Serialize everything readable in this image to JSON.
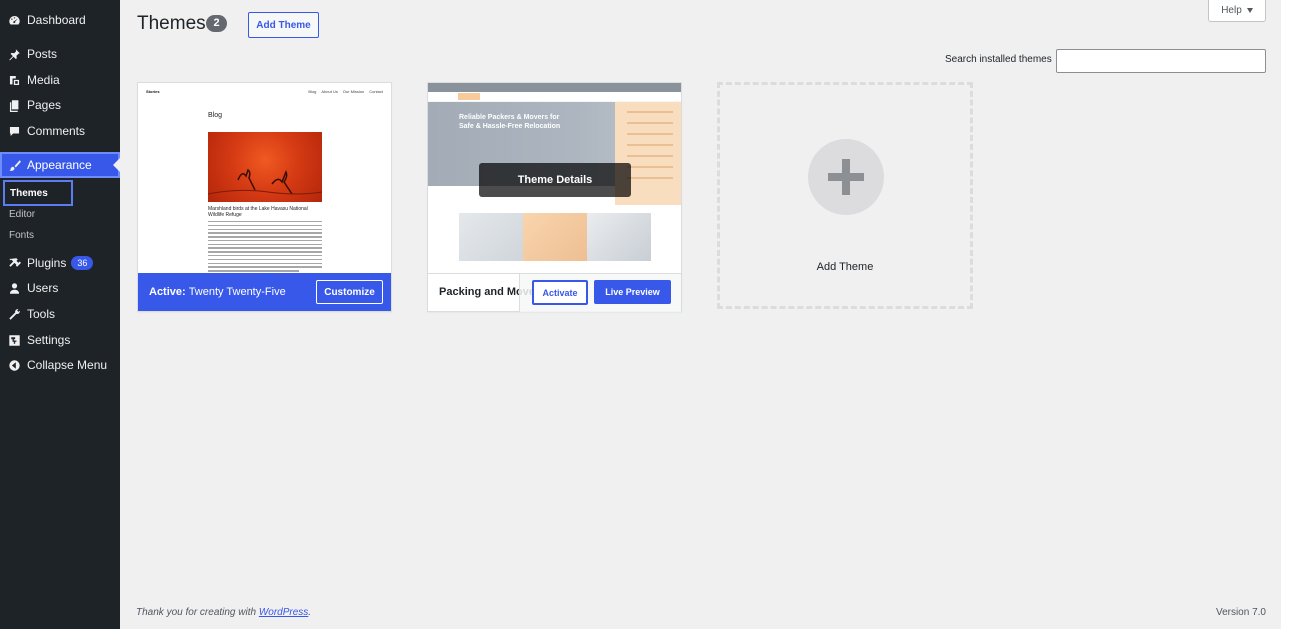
{
  "sidebar": {
    "items": [
      {
        "label": "Dashboard",
        "icon": "dashboard-icon"
      },
      {
        "label": "Posts",
        "icon": "pin-icon"
      },
      {
        "label": "Media",
        "icon": "media-icon"
      },
      {
        "label": "Pages",
        "icon": "pages-icon"
      },
      {
        "label": "Comments",
        "icon": "comments-icon"
      },
      {
        "label": "Appearance",
        "icon": "brush-icon"
      },
      {
        "label": "Plugins",
        "icon": "plugin-icon",
        "badge": "36"
      },
      {
        "label": "Users",
        "icon": "users-icon"
      },
      {
        "label": "Tools",
        "icon": "wrench-icon"
      },
      {
        "label": "Settings",
        "icon": "settings-icon"
      },
      {
        "label": "Collapse Menu",
        "icon": "collapse-icon"
      }
    ],
    "submenu": [
      "Themes",
      "Editor",
      "Fonts"
    ]
  },
  "header": {
    "title": "Themes",
    "count": "2",
    "add_button": "Add Theme",
    "help": "Help"
  },
  "search": {
    "label": "Search installed themes",
    "value": ""
  },
  "themes": {
    "active": {
      "preview_site": "Stories",
      "preview_links": [
        "Blog",
        "About Us",
        "Our Mission",
        "Contact"
      ],
      "preview_blog": "Blog",
      "preview_heading": "Marshland birds at the Lake Havasu National Wildlife Refuge",
      "active_label": "Active:",
      "name": "Twenty Twenty-Five",
      "customize": "Customize"
    },
    "second": {
      "hero_text": "Reliable Packers & Movers for Safe & Hassle-Free Relocation",
      "details": "Theme Details",
      "name": "Packing and Movers",
      "activate": "Activate",
      "live_preview": "Live Preview"
    },
    "add_new": "Add Theme"
  },
  "footer": {
    "thanks_prefix": "Thank you for creating with ",
    "thanks_link": "WordPress",
    "thanks_suffix": ".",
    "version": "Version 7.0"
  },
  "colors": {
    "accent": "#3858e9",
    "sidebar_bg": "#1d2327",
    "page_bg": "#f0f0f1"
  }
}
